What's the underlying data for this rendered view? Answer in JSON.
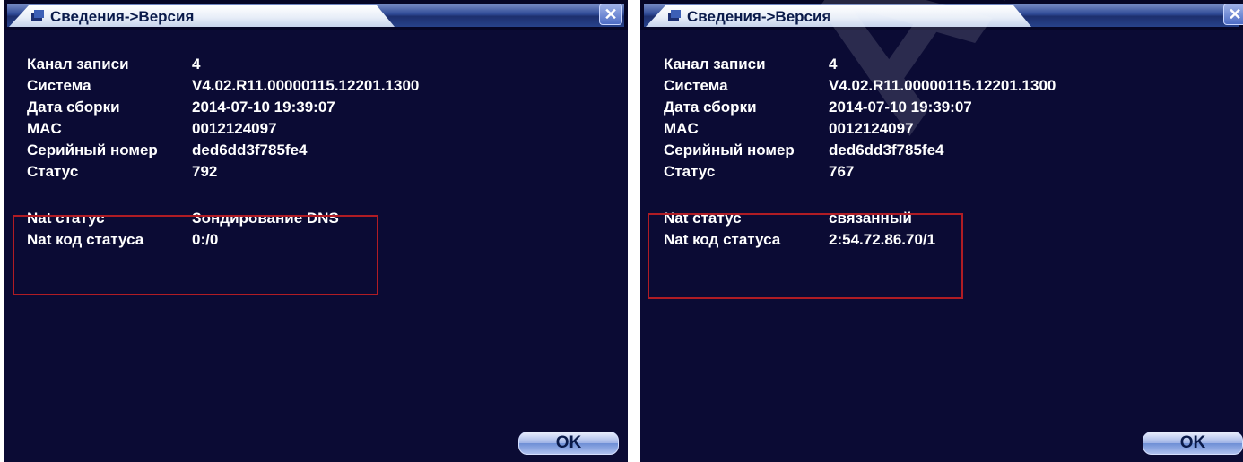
{
  "panels": [
    {
      "title": "Сведения->Версия",
      "close_symbol": "✕",
      "rows": [
        {
          "label": "Канал записи",
          "value": "4"
        },
        {
          "label": "Система",
          "value": "V4.02.R11.00000115.12201.1300"
        },
        {
          "label": "Дата сборки",
          "value": "2014-07-10 19:39:07"
        },
        {
          "label": "MAC",
          "value": "0012124097"
        },
        {
          "label": "Серийный номер",
          "value": "ded6dd3f785fe4"
        },
        {
          "label": "Статус",
          "value": "792"
        }
      ],
      "nat_rows": [
        {
          "label": "Nat статус",
          "value": "Зондирование DNS"
        },
        {
          "label": "Nat код статуса",
          "value": "0:/0"
        }
      ],
      "ok_label": "OK"
    },
    {
      "title": "Сведения->Версия",
      "close_symbol": "✕",
      "rows": [
        {
          "label": "Канал записи",
          "value": "4"
        },
        {
          "label": "Система",
          "value": "V4.02.R11.00000115.12201.1300"
        },
        {
          "label": "Дата сборки",
          "value": "2014-07-10 19:39:07"
        },
        {
          "label": "MAC",
          "value": "0012124097"
        },
        {
          "label": "Серийный номер",
          "value": "ded6dd3f785fe4"
        },
        {
          "label": "Статус",
          "value": "767"
        }
      ],
      "nat_rows": [
        {
          "label": "Nat статус",
          "value": "связанный"
        },
        {
          "label": "Nat код статуса",
          "value": "2:54.72.86.70/1"
        }
      ],
      "ok_label": "OK"
    }
  ],
  "watermark": "Al",
  "colors": {
    "panel_bg": "#0b0b34",
    "highlight": "#b01c24",
    "text": "#ffffff"
  },
  "icons": [
    "info-icon",
    "close-icon"
  ]
}
